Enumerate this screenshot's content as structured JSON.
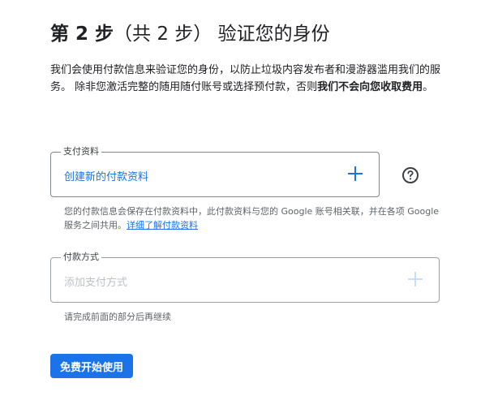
{
  "step": {
    "title_prefix": "第 2 步",
    "title_paren": "（共 2 步）",
    "title_suffix": "验证您的身份"
  },
  "description": {
    "text": "我们会使用付款信息来验证您的身份，以防止垃圾内容发布者和漫游器滥用我们的服务。 除非您激活完整的随用随付账号或选择预付款，否则",
    "bold": "我们不会向您收取费用",
    "end": "。"
  },
  "payments_profile": {
    "label": "支付资料",
    "value": "创建新的付款资料",
    "add_icon": "plus-icon",
    "help_icon": "help-circle-icon",
    "hint_text": "您的付款信息会保存在付款资料中，此付款资料与您的 Google 账号相关联，并在各项 Google 服务之间共用。",
    "hint_link": "详细了解付款资料"
  },
  "payment_method": {
    "label": "付款方式",
    "placeholder": "添加支付方式",
    "add_icon": "plus-icon",
    "hint_text": "请完成前面的部分后再继续"
  },
  "submit_button": {
    "label": "免费开始使用"
  },
  "colors": {
    "accent": "#1a73e8",
    "text": "#202124",
    "muted": "#5f6368"
  }
}
